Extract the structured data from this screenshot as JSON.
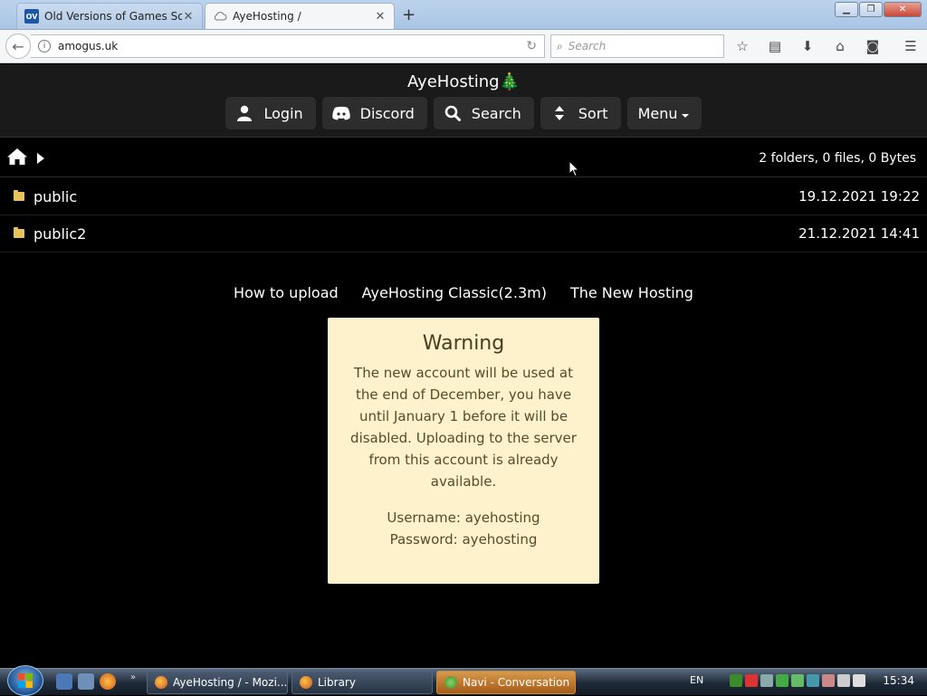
{
  "browser": {
    "tabs": [
      {
        "title": "Old Versions of Games Soft...",
        "icon": "ov-site-icon",
        "icon_text": "OV",
        "active": false
      },
      {
        "title": "AyeHosting /",
        "icon": "cloud-icon",
        "active": true
      }
    ],
    "new_tab": "+",
    "url": "amogus.uk",
    "search_placeholder": "Search"
  },
  "site": {
    "title": "AyeHosting",
    "title_emoji": "🎄",
    "buttons": [
      {
        "label": "Login",
        "icon": "user-icon"
      },
      {
        "label": "Discord",
        "icon": "discord-icon"
      },
      {
        "label": "Search",
        "icon": "search-icon"
      },
      {
        "label": "Sort",
        "icon": "sort-icon"
      },
      {
        "label": "Menu",
        "icon": "caret-down-icon"
      }
    ]
  },
  "listing": {
    "summary": "2 folders, 0 files, 0 Bytes",
    "rows": [
      {
        "name": "public",
        "date": "19.12.2021 19:22"
      },
      {
        "name": "public2",
        "date": "21.12.2021 14:41"
      }
    ]
  },
  "links": [
    "How to upload",
    "AyeHosting Classic(2.3m)",
    "The New Hosting"
  ],
  "warning": {
    "title": "Warning",
    "body": "The new account will be used at the end of December, you have until January 1 before it will be disabled. Uploading to the server from this account is already available.",
    "username": "Username: ayehosting",
    "password": "Password: ayehosting"
  },
  "taskbar": {
    "windows": [
      "AyeHosting / - Mozi...",
      "Library",
      "Navi - Conversation"
    ],
    "language": "EN",
    "time": "15:34"
  },
  "colors": {
    "header_bg": "#1a1a1a",
    "button_bg": "#2d2d2d",
    "warning_bg": "#fdf2cc",
    "folder": "#e6c45a"
  }
}
